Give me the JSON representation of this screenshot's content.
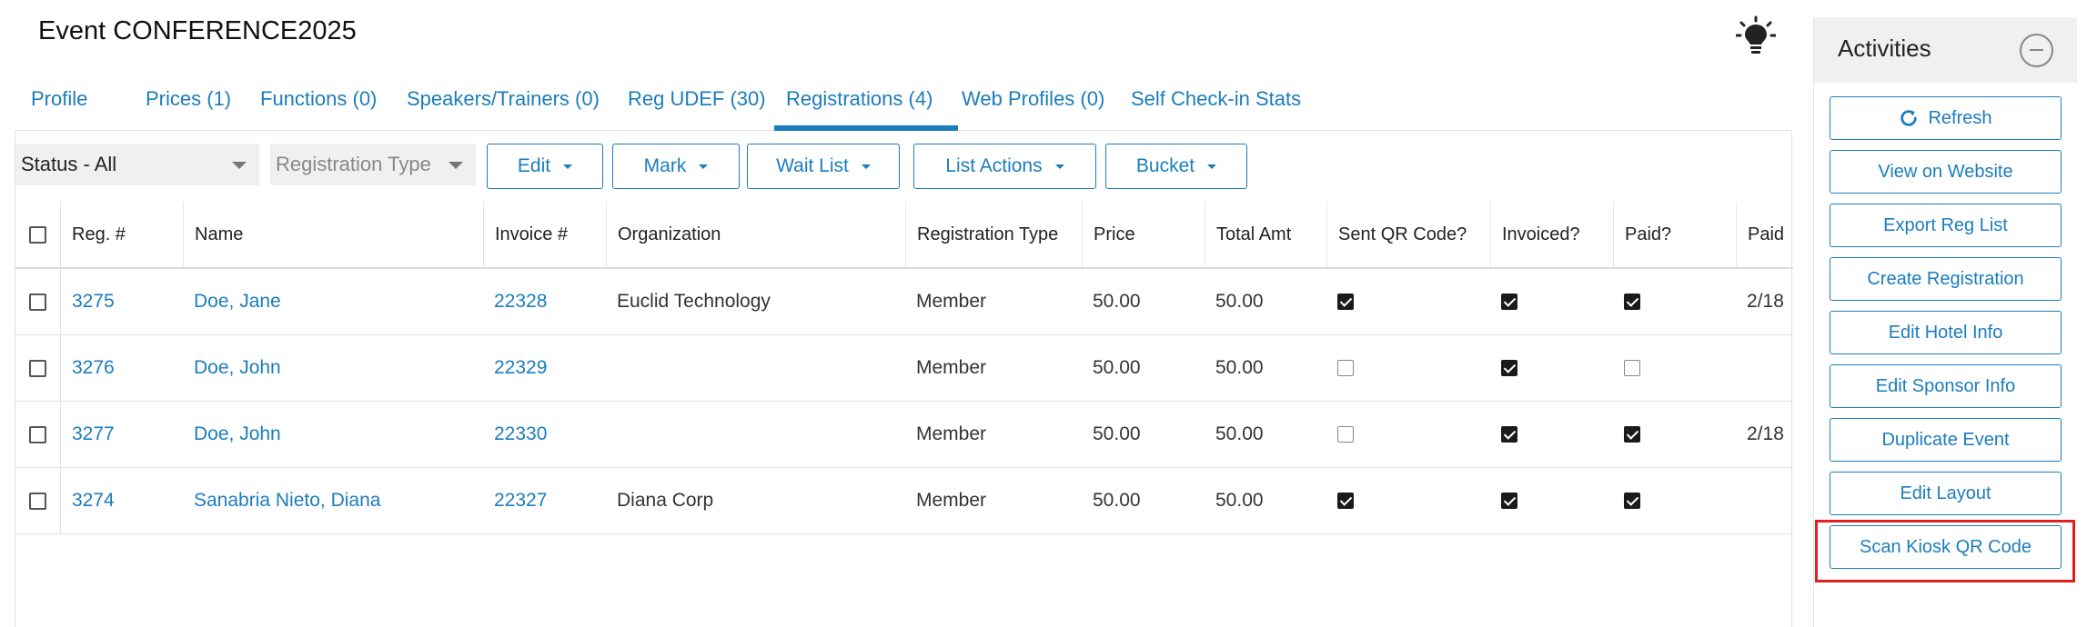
{
  "page": {
    "title": "Event CONFERENCE2025"
  },
  "tabs": [
    {
      "label": "Profile"
    },
    {
      "label": "Prices (1)"
    },
    {
      "label": "Functions (0)"
    },
    {
      "label": "Speakers/Trainers (0)"
    },
    {
      "label": "Reg UDEF (30)"
    },
    {
      "label": "Registrations (4)",
      "active": true
    },
    {
      "label": "Web Profiles (0)"
    },
    {
      "label": "Self Check-in Stats"
    }
  ],
  "filters": {
    "status": "Status - All",
    "registration_type_placeholder": "Registration Type"
  },
  "actions": [
    {
      "label": "Edit"
    },
    {
      "label": "Mark"
    },
    {
      "label": "Wait List"
    },
    {
      "label": "List Actions"
    },
    {
      "label": "Bucket"
    }
  ],
  "table": {
    "columns": [
      "Reg. #",
      "Name",
      "Invoice #",
      "Organization",
      "Registration Type",
      "Price",
      "Total Amt",
      "Sent QR Code?",
      "Invoiced?",
      "Paid?",
      "Paid"
    ],
    "rows": [
      {
        "reg": "3275",
        "name": "Doe, Jane",
        "invoice": "22328",
        "organization": "Euclid Technology",
        "type": "Member",
        "price": "50.00",
        "total": "50.00",
        "sent_qr": true,
        "invoiced": true,
        "paid": true,
        "paid_date": "2/18"
      },
      {
        "reg": "3276",
        "name": "Doe, John",
        "invoice": "22329",
        "organization": "",
        "type": "Member",
        "price": "50.00",
        "total": "50.00",
        "sent_qr": false,
        "invoiced": true,
        "paid": false,
        "paid_date": ""
      },
      {
        "reg": "3277",
        "name": "Doe, John",
        "invoice": "22330",
        "organization": "",
        "type": "Member",
        "price": "50.00",
        "total": "50.00",
        "sent_qr": false,
        "invoiced": true,
        "paid": true,
        "paid_date": "2/18"
      },
      {
        "reg": "3274",
        "name": "Sanabria Nieto, Diana",
        "invoice": "22327",
        "organization": "Diana Corp",
        "type": "Member",
        "price": "50.00",
        "total": "50.00",
        "sent_qr": true,
        "invoiced": true,
        "paid": true,
        "paid_date": ""
      }
    ]
  },
  "sidebar": {
    "title": "Activities",
    "buttons": [
      {
        "label": "Refresh",
        "icon": "refresh-icon"
      },
      {
        "label": "View on Website"
      },
      {
        "label": "Export Reg List"
      },
      {
        "label": "Create Registration"
      },
      {
        "label": "Edit Hotel Info"
      },
      {
        "label": "Edit Sponsor Info"
      },
      {
        "label": "Duplicate Event"
      },
      {
        "label": "Edit Layout"
      },
      {
        "label": "Scan Kiosk QR Code",
        "highlighted": true
      }
    ]
  },
  "colors": {
    "accent": "#1b7dbd",
    "highlight": "#e02020"
  }
}
